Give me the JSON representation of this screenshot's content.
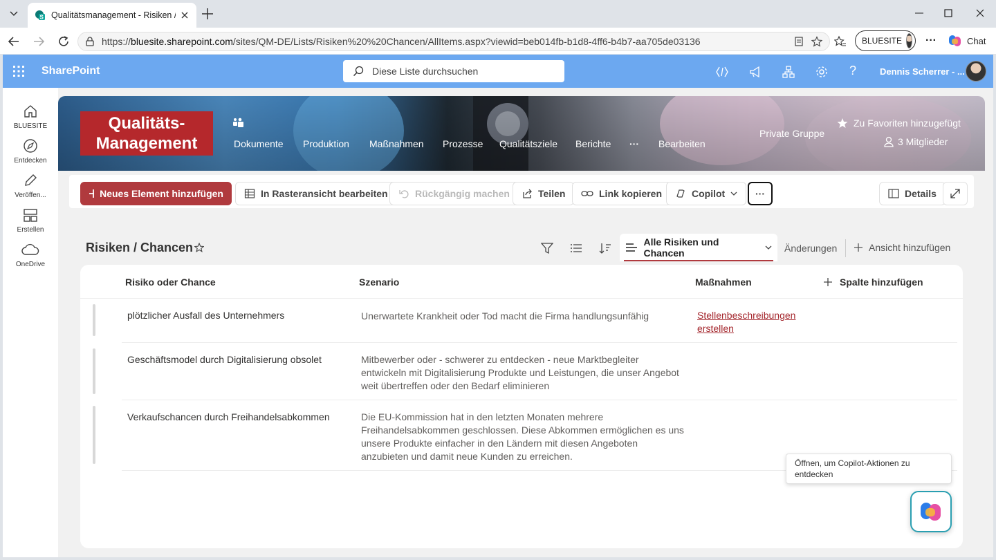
{
  "browser": {
    "tab_title": "Qualitätsmanagement - Risiken / Chancen",
    "url_prefix": "https://",
    "url_host": "bluesite.sharepoint.com",
    "url_path": "/sites/QM-DE/Lists/Risiken%20%20Chancen/AllItems.aspx?viewid=beb014fb-b1d8-4ff6-b4b7-aa705de03136",
    "profile_label": "BLUESITE",
    "chat_label": "Chat"
  },
  "sp_header": {
    "app_name": "SharePoint",
    "search_placeholder": "Diese Liste durchsuchen",
    "user_name": "Dennis Scherrer - ..."
  },
  "rail": {
    "items": [
      {
        "label": "BLUESITE",
        "icon": "home-icon"
      },
      {
        "label": "Entdecken",
        "icon": "compass-icon"
      },
      {
        "label": "Veröffen...",
        "icon": "pen-icon"
      },
      {
        "label": "Erstellen",
        "icon": "layout-icon"
      },
      {
        "label": "OneDrive",
        "icon": "cloud-icon"
      }
    ]
  },
  "site": {
    "logo_line1": "Qualitäts-",
    "logo_line2": "Management",
    "nav": [
      "Dokumente",
      "Produktion",
      "Maßnahmen",
      "Prozesse",
      "Qualitätsziele",
      "Berichte",
      "···",
      "Bearbeiten"
    ],
    "group_type": "Private Gruppe",
    "favorite_label": "Zu Favoriten hinzugefügt",
    "members_label": "3 Mitglieder"
  },
  "commands": {
    "new_item": "Neues Element hinzufügen",
    "grid_edit": "In Rasteransicht bearbeiten",
    "undo": "Rückgängig machen",
    "share": "Teilen",
    "copy_link": "Link kopieren",
    "copilot": "Copilot",
    "more": "···",
    "details": "Details"
  },
  "list": {
    "title": "Risiken / Chancen",
    "current_view": "Alle Risiken und Chancen",
    "view_changes": "Änderungen",
    "add_view": "Ansicht hinzufügen",
    "columns": [
      "Risiko oder Chance",
      "Szenario",
      "Maßnahmen",
      "Spalte hinzufügen"
    ],
    "rows": [
      {
        "title": "plötzlicher Ausfall des Unternehmers",
        "scenario": "Unerwartete Krankheit oder Tod macht die Firma handlungsunfähig",
        "measures": "Stellenbeschreibungen erstellen"
      },
      {
        "title": "Geschäftsmodel durch Digitalisierung obsolet",
        "scenario": "Mitbewerber oder - schwerer zu entdecken - neue Marktbegleiter entwickeln mit Digitalisierung Produkte und Leistungen, die unser Angebot weit übertreffen oder den Bedarf eliminieren",
        "measures": ""
      },
      {
        "title": "Verkaufschancen durch Freihandelsabkommen",
        "scenario": "Die EU-Kommission hat in den letzten Monaten mehrere Freihandelsabkommen geschlossen. Diese Abkommen ermöglichen es uns unsere Produkte einfacher in den Ländern mit diesen Angeboten anzubieten und damit neue Kunden zu erreichen.",
        "measures": ""
      }
    ]
  },
  "copilot_tooltip": "Öffnen, um Copilot-Aktionen zu entdecken",
  "colors": {
    "accent": "#b03a3e",
    "header_blue": "#6ca8f0",
    "link_red": "#a4262c",
    "copilot_border": "#2a9fb1"
  }
}
